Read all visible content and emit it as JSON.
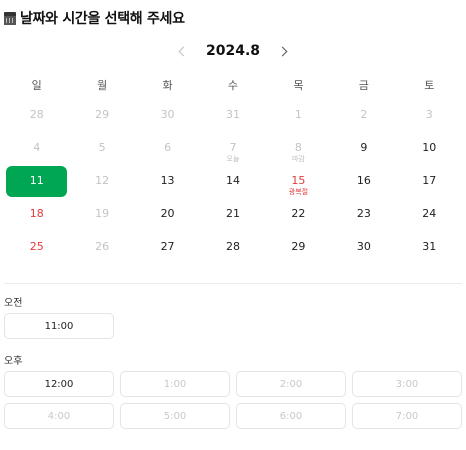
{
  "header": {
    "icon": "calendar-icon",
    "title": "날짜와 시간을 선택해 주세요"
  },
  "calendar": {
    "month_label": "2024.8",
    "weekdays": [
      "일",
      "월",
      "화",
      "수",
      "목",
      "금",
      "토"
    ],
    "days": [
      {
        "label": "28",
        "state": "muted"
      },
      {
        "label": "29",
        "state": "muted"
      },
      {
        "label": "30",
        "state": "muted"
      },
      {
        "label": "31",
        "state": "muted"
      },
      {
        "label": "1",
        "state": "muted"
      },
      {
        "label": "2",
        "state": "muted"
      },
      {
        "label": "3",
        "state": "muted"
      },
      {
        "label": "4",
        "state": "muted"
      },
      {
        "label": "5",
        "state": "muted"
      },
      {
        "label": "6",
        "state": "muted"
      },
      {
        "label": "7",
        "state": "muted",
        "note": "오늘"
      },
      {
        "label": "8",
        "state": "muted",
        "note": "마감"
      },
      {
        "label": "9",
        "state": "normal"
      },
      {
        "label": "10",
        "state": "normal"
      },
      {
        "label": "11",
        "state": "selected"
      },
      {
        "label": "12",
        "state": "muted"
      },
      {
        "label": "13",
        "state": "normal"
      },
      {
        "label": "14",
        "state": "normal"
      },
      {
        "label": "15",
        "state": "red",
        "note": "광복절"
      },
      {
        "label": "16",
        "state": "normal"
      },
      {
        "label": "17",
        "state": "normal"
      },
      {
        "label": "18",
        "state": "red"
      },
      {
        "label": "19",
        "state": "muted"
      },
      {
        "label": "20",
        "state": "normal"
      },
      {
        "label": "21",
        "state": "normal"
      },
      {
        "label": "22",
        "state": "normal"
      },
      {
        "label": "23",
        "state": "normal"
      },
      {
        "label": "24",
        "state": "normal"
      },
      {
        "label": "25",
        "state": "red"
      },
      {
        "label": "26",
        "state": "muted"
      },
      {
        "label": "27",
        "state": "normal"
      },
      {
        "label": "28",
        "state": "normal"
      },
      {
        "label": "29",
        "state": "normal"
      },
      {
        "label": "30",
        "state": "normal"
      },
      {
        "label": "31",
        "state": "normal"
      }
    ]
  },
  "time": {
    "am_label": "오전",
    "am_slots": [
      {
        "label": "11:00",
        "enabled": true
      }
    ],
    "pm_label": "오후",
    "pm_slots": [
      {
        "label": "12:00",
        "enabled": true
      },
      {
        "label": "1:00",
        "enabled": false
      },
      {
        "label": "2:00",
        "enabled": false
      },
      {
        "label": "3:00",
        "enabled": false
      },
      {
        "label": "4:00",
        "enabled": false
      },
      {
        "label": "5:00",
        "enabled": false
      },
      {
        "label": "6:00",
        "enabled": false
      },
      {
        "label": "7:00",
        "enabled": false
      }
    ]
  },
  "colors": {
    "accent": "#00a651",
    "holiday": "#e23b3b",
    "muted": "#c4c4c4"
  }
}
